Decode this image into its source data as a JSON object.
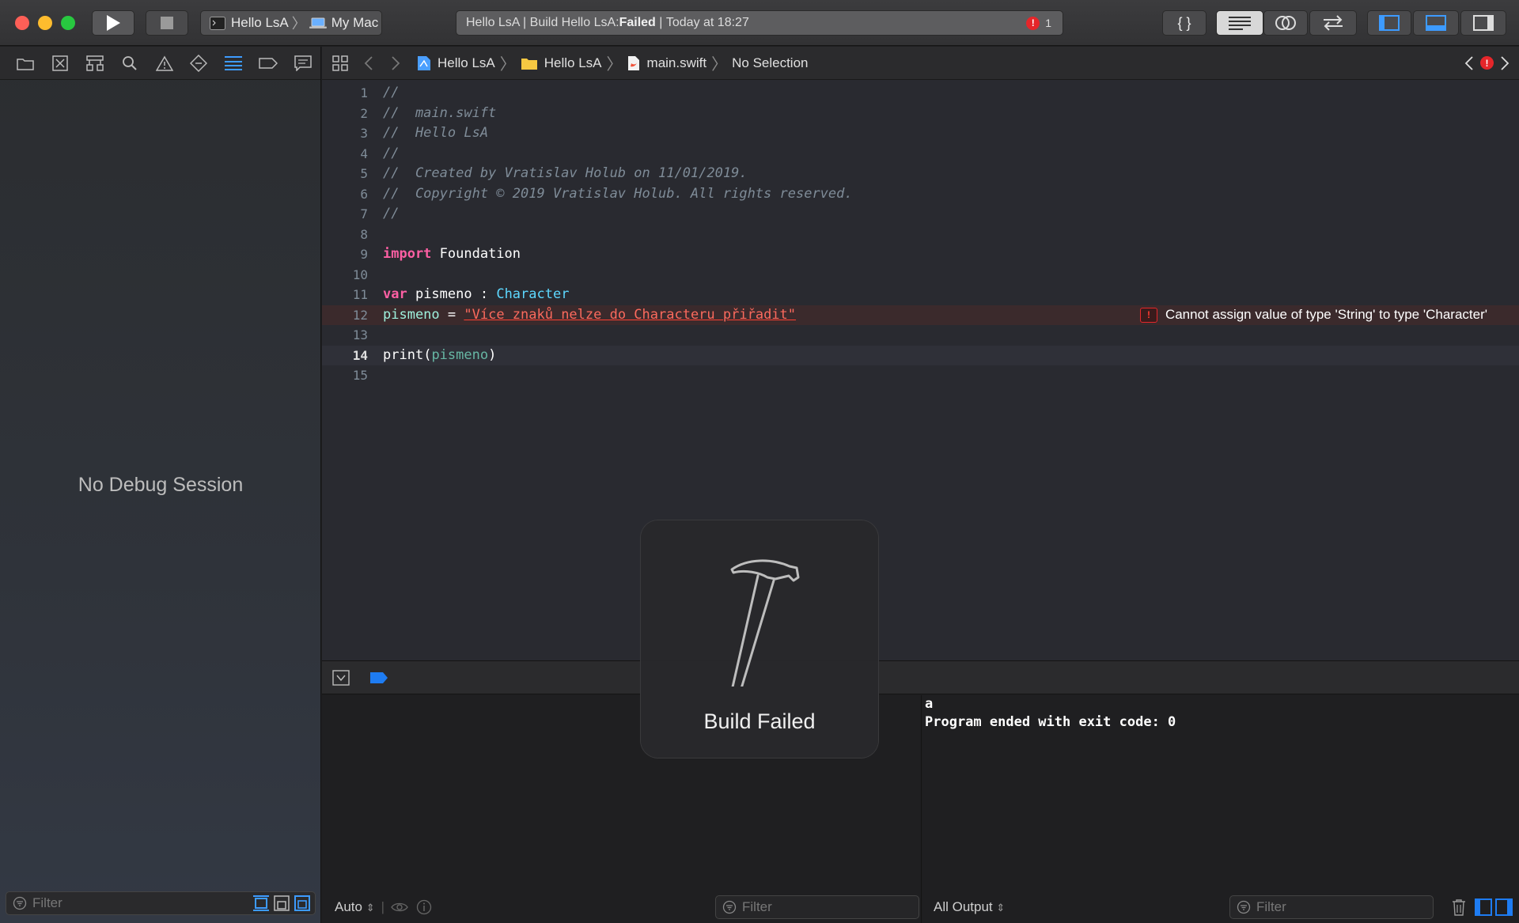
{
  "toolbar": {
    "scheme": "Hello LsA",
    "destination": "My Mac",
    "activity_prefix": "Hello LsA | Build Hello LsA: ",
    "activity_status": "Failed",
    "activity_time": "Today at 18:27",
    "error_count": "1",
    "code_review_label": "{ }"
  },
  "navigator": {
    "message": "No Debug Session",
    "filter_placeholder": "Filter"
  },
  "jumpbar": {
    "project": "Hello LsA",
    "group": "Hello LsA",
    "file": "main.swift",
    "selection": "No Selection"
  },
  "editor": {
    "line_numbers": [
      "1",
      "2",
      "3",
      "4",
      "5",
      "6",
      "7",
      "8",
      "9",
      "10",
      "11",
      "12",
      "13",
      "14",
      "15"
    ],
    "lines": {
      "l1": "//",
      "l2": "//  main.swift",
      "l3": "//  Hello LsA",
      "l4": "//",
      "l5": "//  Created by Vratislav Holub on 11/01/2019.",
      "l6": "//  Copyright © 2019 Vratislav Holub. All rights reserved.",
      "l7": "//",
      "l9_kw": "import",
      "l9_rest": " Foundation",
      "l11_kw": "var",
      "l11_name": " pismeno ",
      "l11_colon": ": ",
      "l11_type": "Character",
      "l12_name": "pismeno",
      "l12_eq": " = ",
      "l12_str": "\"Více znaků nelze do Characteru přiřadit\"",
      "l14_fn": "print",
      "l14_open": "(",
      "l14_arg": "pismeno",
      "l14_close": ")"
    },
    "error_message": "Cannot assign value of type 'String' to type 'Character'"
  },
  "debug": {
    "variables_scope": "Auto",
    "variables_filter_placeholder": "Filter",
    "console_output": "a\nProgram ended with exit code: 0",
    "console_scope": "All Output",
    "console_filter_placeholder": "Filter"
  },
  "hud": {
    "title": "Build Failed"
  }
}
